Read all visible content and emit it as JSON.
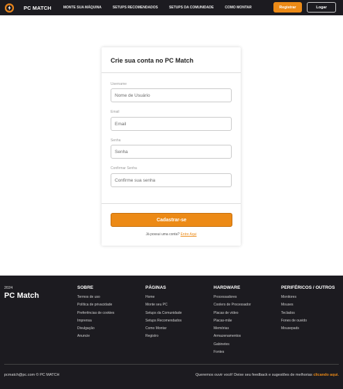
{
  "navbar": {
    "brand": "PC MATCH",
    "links": [
      "MONTE SUA MÁQUINA",
      "SETUPS RECOMENDADOS",
      "SETUPS DA COMUNIDADE",
      "COMO MONTAR"
    ],
    "register_label": "Registrar",
    "login_label": "Logar"
  },
  "form": {
    "title": "Crie sua conta no PC Match",
    "username": {
      "label": "Username",
      "placeholder": "Nome de Usuário"
    },
    "email": {
      "label": "Email",
      "placeholder": "Email"
    },
    "password": {
      "label": "Senha",
      "placeholder": "Senha"
    },
    "confirm": {
      "label": "Confirmar Senha",
      "placeholder": "Confirme sua senha"
    },
    "submit_label": "Cadastrar-se",
    "login_prompt": "Já possui uma conta?",
    "login_link": "Entre Aqui"
  },
  "footer": {
    "year": "2024",
    "brand": "PC Match",
    "sobre": {
      "title": "SOBRE",
      "items": [
        "Termos de uso",
        "Política de privacidade",
        "Preferências de cookies",
        "Imprensa",
        "Divulgação",
        "Anuncie"
      ]
    },
    "paginas": {
      "title": "PÁGINAS",
      "items": [
        "Home",
        "Monte seu PC",
        "Setups da Comunidade",
        "Setups Recomendados",
        "Como Montar",
        "Registro"
      ]
    },
    "hardware": {
      "title": "HARDWARE",
      "items": [
        "Processadores",
        "Coolers de Processador",
        "Placas de vídeo",
        "Placas-mãe",
        "Memórias",
        "Armazenamentos",
        "Gabinetes",
        "Fontes"
      ]
    },
    "perifericos": {
      "title": "PERIFÉRICOS / OUTROS",
      "items": [
        "Monitores",
        "Mouses",
        "Teclados",
        "Fones de ouvido",
        "Mousepads"
      ]
    },
    "copyright": "pcmatch@pc.com © PC MATCH",
    "feedback_text": "Queremos ouvir você! Deixe seu feedback e sugestões de melhorias",
    "feedback_link": "clicando aqui."
  },
  "colors": {
    "accent": "#ec8a16",
    "dark": "#1c1b20"
  }
}
